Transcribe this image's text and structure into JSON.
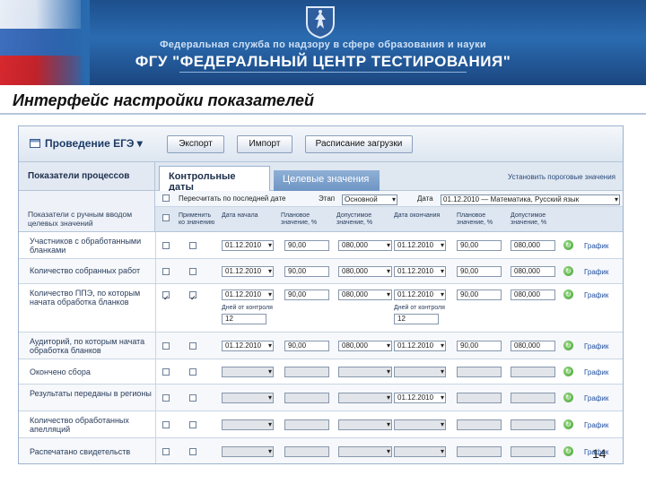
{
  "banner": {
    "subtitle": "Федеральная служба по надзору в сфере образования и науки",
    "title": "ФГУ \"ФЕДЕРАЛЬНЫЙ ЦЕНТР ТЕСТИРОВАНИЯ\"",
    "colors": {
      "blue": "#2a6bb0",
      "red": "#d7282f"
    }
  },
  "slide_title": "Интерфейс настройки показателей",
  "toolbar": {
    "menu": "Проведение ЕГЭ",
    "export": "Экспорт",
    "import": "Импорт",
    "schedule": "Расписание загрузки"
  },
  "left_panel": {
    "header": "Показатели процессов",
    "subheader": "Показатели с ручным вводом целевых значений"
  },
  "tabs": {
    "active": "Контрольные даты",
    "inactive": "Целевые значения",
    "link": "Установить пороговые значения"
  },
  "filter": {
    "recalc_label": "Пересчитать по последней дате",
    "stage_label": "Этап",
    "stage_value": "Основной",
    "date_label": "Дата",
    "date_value": "01.12.2010 — Математика, Русский язык"
  },
  "columns": {
    "apply": "Применить ко значению",
    "date": "Дата начала",
    "plan": "Плановое значение, %",
    "allowed": "Допустимое значение, %",
    "date_end": "Дата окончания",
    "plan_end": "Плановое значение, %",
    "allowed_end": "Допустимое значение, %"
  },
  "rows": [
    {
      "label": "Участников с обработанными бланками",
      "date": "01.12.2010",
      "plan": "90,00",
      "allowed": "080,000",
      "date_end": "01.12.2010",
      "plan_end": "90,00",
      "allowed_end": "080,000",
      "link": "График"
    },
    {
      "label": "Количество собранных работ",
      "date": "01.12.2010",
      "plan": "90,00",
      "allowed": "080,000",
      "date_end": "01.12.2010",
      "plan_end": "90,00",
      "allowed_end": "080,000",
      "link": "График"
    },
    {
      "label": "Количество ППЭ, по которым начата обработка бланков",
      "date": "01.12.2010",
      "plan": "90,00",
      "allowed": "080,000",
      "date_end": "01.12.2010",
      "plan_end": "90,00",
      "allowed_end": "080,000",
      "link": "График",
      "extra_label": "Дней от контроля",
      "extra_value": "12"
    },
    {
      "label": "Аудиторий, по которым начата обработка бланков",
      "date": "01.12.2010",
      "plan": "90,00",
      "allowed": "080,000",
      "date_end": "01.12.2010",
      "plan_end": "90,00",
      "allowed_end": "080,000",
      "link": "График"
    },
    {
      "label": "Окончено сбора",
      "link": "График"
    },
    {
      "label": "Результаты переданы в регионы",
      "date_end": "01.12.2010",
      "link": "График"
    },
    {
      "label": "Количество обработанных апелляций",
      "link": "График"
    },
    {
      "label": "Распечатано свидетельств",
      "link": "График"
    }
  ],
  "page_number": "14"
}
